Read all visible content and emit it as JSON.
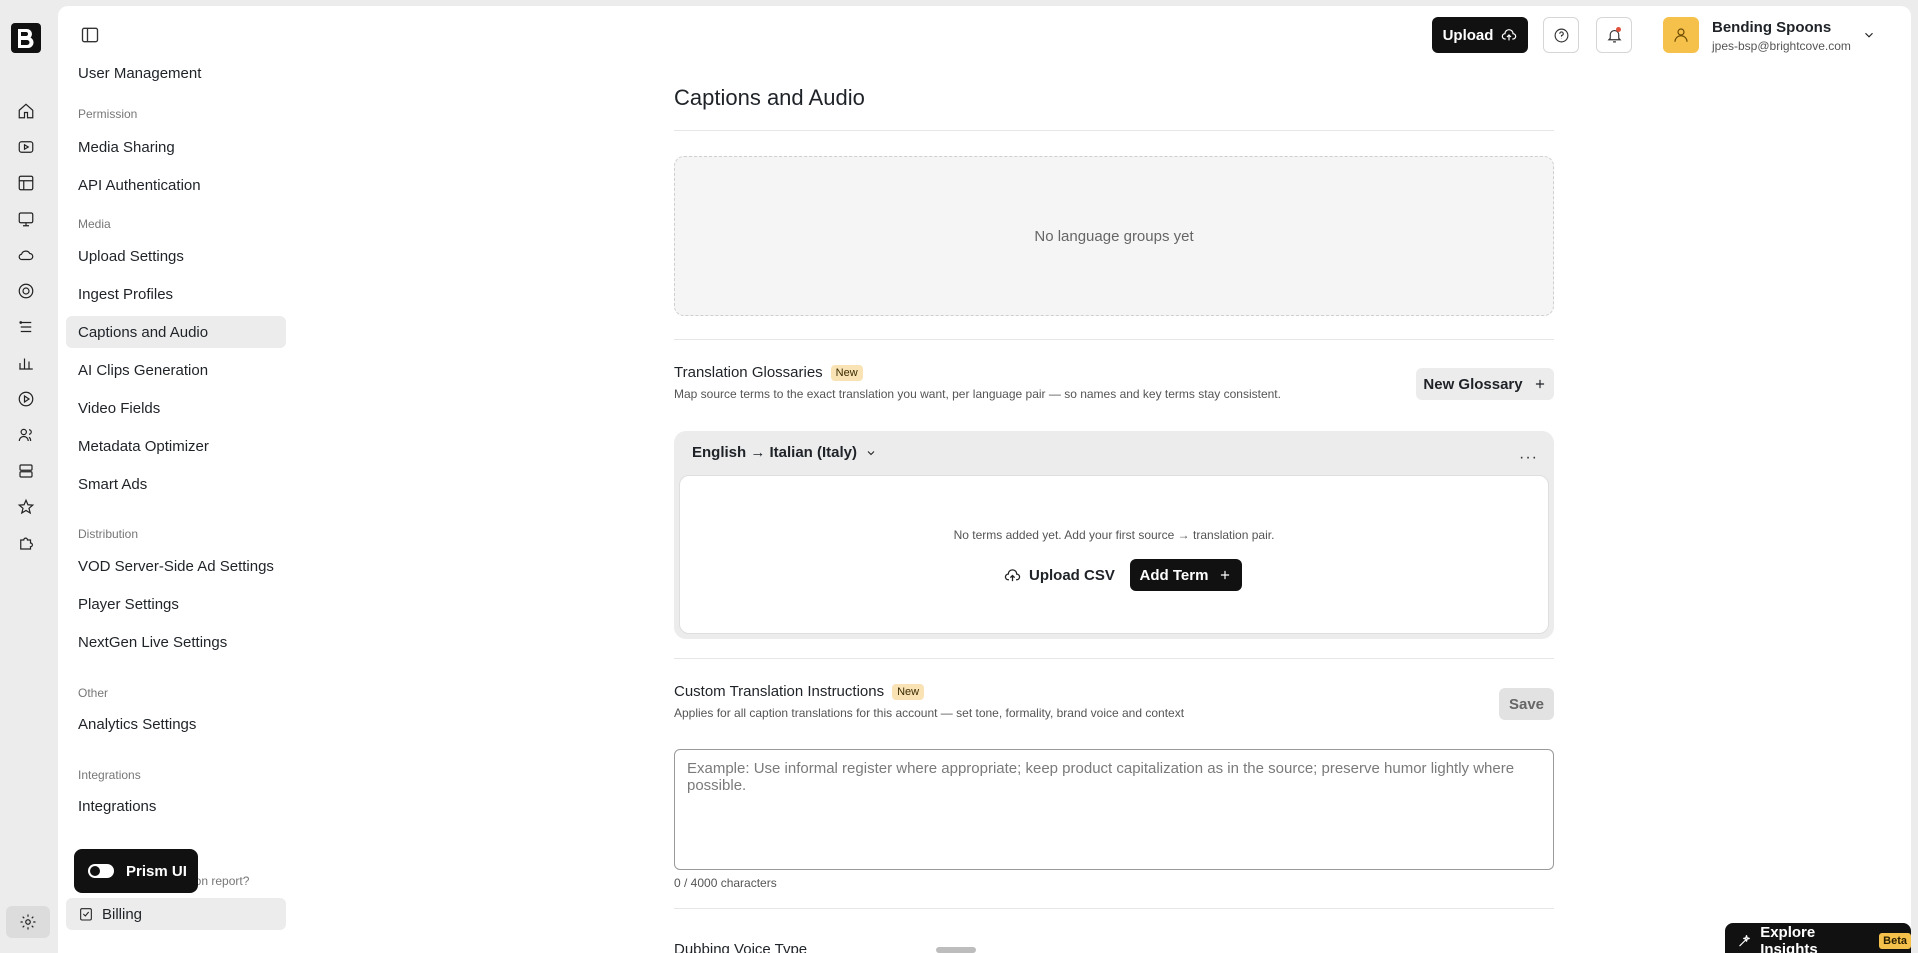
{
  "header": {
    "upload_label": "Upload",
    "account_name": "Bending Spoons",
    "account_email": "jpes-bsp@brightcove.com"
  },
  "nav": {
    "top_item": "User Management",
    "sections": [
      {
        "label": "Permission",
        "items": [
          "Media Sharing",
          "API Authentication"
        ]
      },
      {
        "label": "Media",
        "items": [
          "Upload Settings",
          "Ingest Profiles",
          "Captions and Audio",
          "AI Clips Generation",
          "Video Fields",
          "Metadata Optimizer",
          "Smart Ads"
        ]
      },
      {
        "label": "Distribution",
        "items": [
          "VOD Server-Side Ad Settings",
          "Player Settings",
          "NextGen Live Settings"
        ]
      },
      {
        "label": "Other",
        "items": [
          "Analytics Settings"
        ]
      },
      {
        "label": "Integrations",
        "items": [
          "Integrations"
        ]
      }
    ],
    "partial_text": "zation report?",
    "billing_label": "Billing",
    "active_item": "Captions and Audio"
  },
  "prism": {
    "label": "Prism UI",
    "enabled": true
  },
  "page": {
    "title": "Captions and Audio",
    "language_groups_empty": "No language groups yet"
  },
  "glossary": {
    "title": "Translation Glossaries",
    "badge": "New",
    "description": "Map source terms to the exact translation you want, per language pair — so names and key terms stay consistent.",
    "new_button": "New Glossary",
    "pair": "English → Italian (Italy)",
    "more": "···",
    "empty_text": "No terms added yet. Add your first source → translation pair.",
    "upload_csv": "Upload CSV",
    "add_term": "Add Term"
  },
  "instructions": {
    "title": "Custom Translation Instructions",
    "badge": "New",
    "description": "Applies for all caption translations for this account — set tone, formality, brand voice and context",
    "save_label": "Save",
    "placeholder": "Example: Use informal register where appropriate; keep product capitalization as in the source; preserve humor lightly where possible.",
    "char_count": "0 / 4000 characters"
  },
  "dubbing": {
    "title": "Dubbing Voice Type"
  },
  "explore": {
    "label": "Explore Insights",
    "badge": "Beta"
  },
  "colors": {
    "accent": "#111111",
    "badge_new": "#f9e3b5",
    "avatar": "#f6c14a",
    "active_nav": "#ececec"
  },
  "icons": [
    "home-icon",
    "video-icon",
    "library-icon",
    "channel-icon",
    "cloud-icon",
    "live-icon",
    "stack-icon",
    "analytics-icon",
    "player-icon",
    "users-icon",
    "server-icon",
    "star-icon",
    "puzzle-icon",
    "gear-icon"
  ]
}
